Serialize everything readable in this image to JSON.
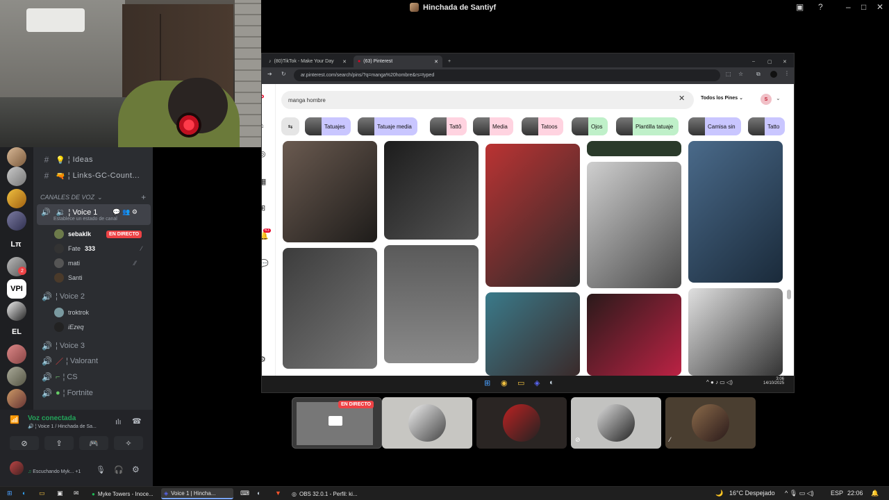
{
  "window": {
    "title": "Hinchada de Santiyf"
  },
  "discord": {
    "channels": [
      {
        "icon": "#",
        "emoji": "💡",
        "label": "Ideas"
      },
      {
        "icon": "#",
        "emoji": "🔫",
        "label": "Links-GC-Count..."
      }
    ],
    "voice_category": "CANALES DE VOZ",
    "voice1": {
      "label": "Voice 1",
      "status_placeholder": "Establece un estado de canal"
    },
    "voice1_users": [
      {
        "name": "sebaklk",
        "badge": "EN DIRECTO"
      },
      {
        "name": "Fate",
        "extra": "333"
      },
      {
        "name": "mati"
      },
      {
        "name": "Santi"
      }
    ],
    "voice2": {
      "label": "Voice 2"
    },
    "voice2_users": [
      {
        "name": "troktrok"
      },
      {
        "name": "iEzeq"
      }
    ],
    "voice3": {
      "label": "Voice 3"
    },
    "valorant": {
      "label": "Valorant"
    },
    "cs": {
      "label": "CS"
    },
    "fortnite": {
      "label": "Fortnite"
    },
    "servers": [
      "Lπ",
      "VPI",
      "EL"
    ],
    "server_badge": "2",
    "voice_status": {
      "title": "Voz conectada",
      "subtitle": "Voice 1 / Hinchada de Sa..."
    },
    "user_status": {
      "text": "Escuchando Myk...",
      "extra": "+1"
    }
  },
  "browser": {
    "tabs": [
      {
        "label": "(80)TikTok - Make Your Day"
      },
      {
        "label": "(63) Pinterest"
      }
    ],
    "url": "ar.pinterest.com/search/pins/?q=manga%20hombre&rs=typed",
    "pinterest": {
      "search_value": "manga hombre",
      "filter_label": "Todos los Pines",
      "user_initial": "S",
      "notif_count": "63",
      "chips": [
        "Tatuajes",
        "Tatuaje media",
        "Tattô",
        "Media",
        "Tatoos",
        "Ojos",
        "Plantilla tatuaje",
        "Camisa sin",
        "Tatto"
      ]
    },
    "clock": {
      "time": "3:06",
      "date": "14/10/2025"
    }
  },
  "stage": {
    "live_badge": "EN DIRECTO"
  },
  "taskbar": {
    "apps": [
      {
        "label": "Myke Towers - Inoce..."
      },
      {
        "label": "Voice 1 | Hincha..."
      },
      {
        "label": "OBS 32.0.1 - Perfil: ki..."
      }
    ],
    "weather": "16°C  Despejado",
    "lang": "ESP",
    "time": "22:06"
  },
  "colors": {
    "discord_bg": "#2b2d31",
    "discord_accent": "#23a55a",
    "live_red": "#ed4245",
    "pinterest_red": "#e60023",
    "chip_purple": "#c9c6ff",
    "chip_pink": "#ffd3e0",
    "chip_green": "#bff0c9"
  }
}
